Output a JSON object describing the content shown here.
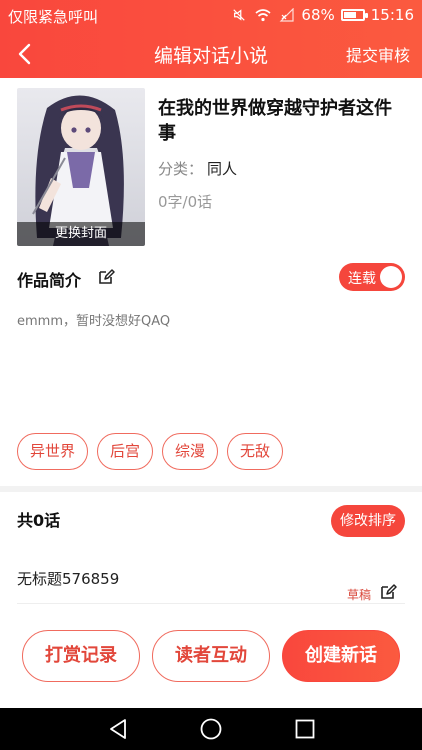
{
  "status_bar": {
    "carrier": "仅限紧急呼叫",
    "battery": "68%",
    "battery_level": 0.68,
    "time": "15:16",
    "icons": [
      "mute-icon",
      "wifi-icon",
      "no-sim-icon",
      "battery-icon"
    ]
  },
  "navbar": {
    "title": "编辑对话小说",
    "submit_label": "提交审核",
    "back_icon": "chevron-left-icon"
  },
  "book": {
    "cover_caption": "更换封面",
    "title": "在我的世界做穿越守护者这件事",
    "category_label": "分类：",
    "category_value": "同人",
    "counts": "0字/0话"
  },
  "intro": {
    "label": "作品简介",
    "toggle_label": "连载",
    "toggle_on": true,
    "text": "emmm，暂时没想好QAQ"
  },
  "tags": [
    "异世界",
    "后宫",
    "综漫",
    "无敌"
  ],
  "chapters": {
    "count_label": "共0话",
    "sort_label": "修改排序",
    "items": [
      {
        "title": "无标题576859",
        "status": "草稿"
      }
    ]
  },
  "actions": {
    "reward_label": "打赏记录",
    "interact_label": "读者互动",
    "create_label": "创建新话"
  },
  "colors": {
    "accent": "#f5463c",
    "accent_text": "#e2473b"
  }
}
